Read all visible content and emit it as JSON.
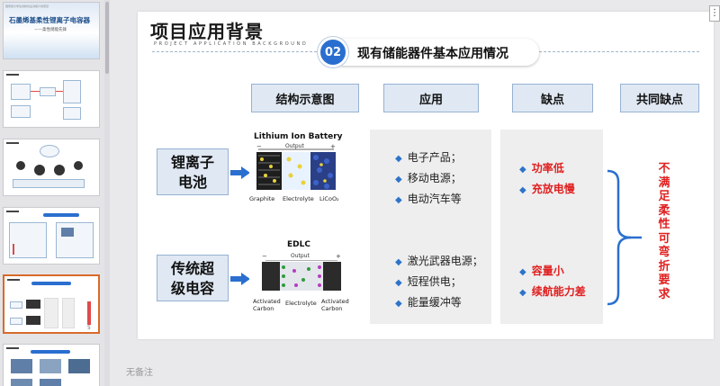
{
  "thumbnails": {
    "cover_title": "石墨烯基柔性锂离子电容器",
    "cover_subtitle": "——柔性储能先锋",
    "cover_header": "国家级大学生创新创业训练计划项目",
    "slide_number": "5"
  },
  "slide": {
    "title": "项目应用背景",
    "subtitle": "PROJECT APPLICATION BACKGROUND",
    "badge_number": "02",
    "badge_text": "现有储能器件基本应用情况",
    "headers": {
      "structure": "结构示意图",
      "application": "应用",
      "drawback": "缺点",
      "common": "共同缺点"
    },
    "rows": {
      "battery": {
        "label_line1": "锂离子",
        "label_line2": "电池",
        "diagram_title": "Lithium Ion Battery",
        "diagram_output": "Output",
        "diagram_minus": "−",
        "diagram_plus": "+",
        "diagram_left": "Graphite",
        "diagram_mid": "Electrolyte",
        "diagram_right": "LiCoO₂",
        "applications": [
          "电子产品；",
          "移动电源；",
          "电动汽车等"
        ],
        "drawbacks": [
          "功率低",
          "充放电慢"
        ]
      },
      "capacitor": {
        "label_line1": "传统超",
        "label_line2": "级电容",
        "diagram_title": "EDLC",
        "diagram_output": "Output",
        "diagram_minus": "−",
        "diagram_plus": "+",
        "diagram_left_1": "Activated",
        "diagram_left_2": "Carbon",
        "diagram_mid": "Electrolyte",
        "diagram_right_1": "Activated",
        "diagram_right_2": "Carbon",
        "applications": [
          "激光武器电源；",
          "短程供电；",
          "能量缓冲等"
        ],
        "drawbacks": [
          "容量小",
          "续航能力差"
        ]
      }
    },
    "common_drawback": [
      "不",
      "满",
      "足",
      "柔",
      "性",
      "可",
      "弯",
      "折",
      "要",
      "求"
    ]
  },
  "notes_placeholder": "无备注",
  "colors": {
    "accent_blue": "#2a6fcf",
    "header_fill": "#dfe8f3",
    "header_border": "#97b2d2",
    "warning_red": "#e02020",
    "active_thumb_border": "#d86a2b"
  }
}
